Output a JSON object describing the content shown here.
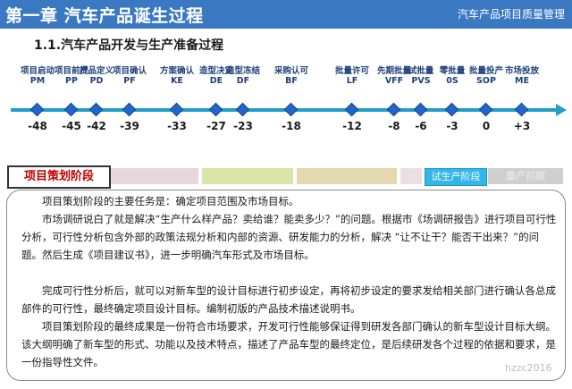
{
  "header": {
    "title": "第一章   汽车产品诞生过程",
    "right_label": "汽车产品项目质量管理"
  },
  "subtitle": "1.1.汽车产品开发与生产准备过程",
  "milestones": [
    {
      "label": "项目启动PM",
      "week": "-48"
    },
    {
      "label": "项目前提PP",
      "week": "-45"
    },
    {
      "label": "产品定义PD",
      "week": "-42"
    },
    {
      "label": "项目确认PF",
      "week": "-39"
    },
    {
      "label": "方案确认KE",
      "week": "-33"
    },
    {
      "label": "造型决定DE",
      "week": "-27"
    },
    {
      "label": "造型冻结DF",
      "week": "-23"
    },
    {
      "label": "采购认可BF",
      "week": "-18"
    },
    {
      "label": "批量许可LF",
      "week": "-12"
    },
    {
      "label": "先期批量VFF",
      "week": "-8"
    },
    {
      "label": "试批量PVS",
      "week": "-6"
    },
    {
      "label": "零批量0S",
      "week": "-3"
    },
    {
      "label": "批量投产SOP",
      "week": "0"
    },
    {
      "label": "市场投放ME",
      "week": "+3"
    }
  ],
  "phases": [
    {
      "label": "项目策划阶段",
      "style": "active"
    },
    {
      "label": "",
      "style": "faded"
    },
    {
      "label": "",
      "style": "faded3"
    },
    {
      "label": "",
      "style": "faded4"
    },
    {
      "label": "",
      "style": "faded2"
    },
    {
      "label": "试生产阶段",
      "style": "prod"
    },
    {
      "label": "量产初期",
      "style": "ramp"
    }
  ],
  "paragraphs": [
    "项目策划阶段的主要任务是：确定项目范围及市场目标。",
    "市场调研说白了就是解决“生产什么样产品？卖给谁？能卖多少？”的问题。根据市《场调研报告》进行项目可行性分析，可行性分析包含外部的政策法规分析和内部的资源、研发能力的分析，解决 “让不让干？能否干出来？”的问题。然后生成《项目建议书》，进一步明确汽车形式及市场目标。",
    "完成可行性分析后，就可以对新车型的设计目标进行初步设定，再将初步设定的要求发给相关部门进行确认各总成部件的可行性，最终确定项目设计目标。编制初版的产品技术描述说明书。",
    "项目策划阶段的最终成果是一份符合市场要求，开发可行性能够保证得到研发各部门确认的新车型设计目标大纲。该大纲明确了新车型的形式、功能以及技术特点，描述了产品车型的最终定位，是后续研发各个过程的依据和要求，是一份指导性文件。"
  ],
  "watermark": "hzzc2016"
}
